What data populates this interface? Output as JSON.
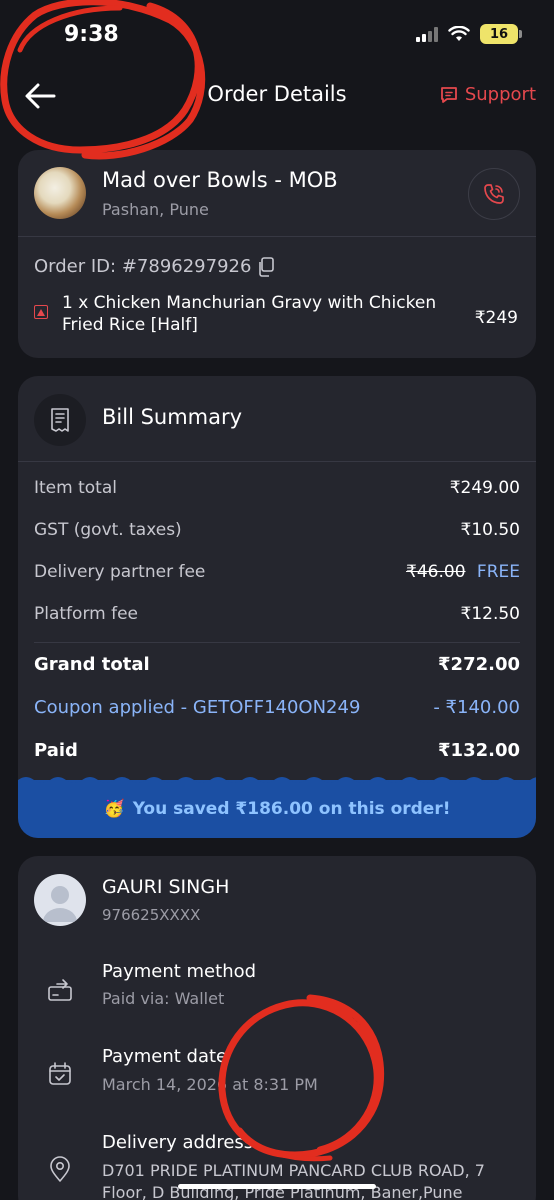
{
  "status_bar": {
    "time": "9:38",
    "battery": "16"
  },
  "header": {
    "title": "Order Details",
    "support_label": "Support"
  },
  "restaurant": {
    "name": "Mad over Bowls - MOB",
    "location": "Pashan, Pune"
  },
  "order": {
    "order_id": "Order ID: #7896297926",
    "item_name": "1 x Chicken Manchurian Gravy with Chicken Fried Rice [Half]",
    "item_price": "₹249"
  },
  "bill": {
    "title": "Bill Summary",
    "item_total_label": "Item total",
    "item_total_value": "₹249.00",
    "gst_label": "GST (govt. taxes)",
    "gst_value": "₹10.50",
    "delivery_label": "Delivery partner fee",
    "delivery_original": "₹46.00",
    "delivery_value": "FREE",
    "platform_label": "Platform fee",
    "platform_value": "₹12.50",
    "grand_total_label": "Grand total",
    "grand_total_value": "₹272.00",
    "coupon_label": "Coupon applied - GETOFF140ON249",
    "coupon_value": "- ₹140.00",
    "paid_label": "Paid",
    "paid_value": "₹132.00",
    "saved_text": "You saved ₹186.00 on this order!",
    "saved_emoji": "🥳"
  },
  "customer": {
    "name": "GAURI SINGH",
    "phone": "976625XXXX",
    "payment_method_label": "Payment method",
    "payment_method_value": "Paid via: Wallet",
    "payment_date_label": "Payment date",
    "payment_date_value": "March 14, 2026 at 8:31 PM",
    "delivery_address_label": "Delivery address",
    "delivery_address_value": "D701 PRIDE PLATINUM PANCARD CLUB ROAD, 7 Floor, D Building, Pride Platinum, Baner,Pune"
  },
  "colors": {
    "accent_red": "#e5484d",
    "accent_blue": "#8ab4f8",
    "banner_blue": "#1b4fa3",
    "card_bg": "#25262e"
  }
}
